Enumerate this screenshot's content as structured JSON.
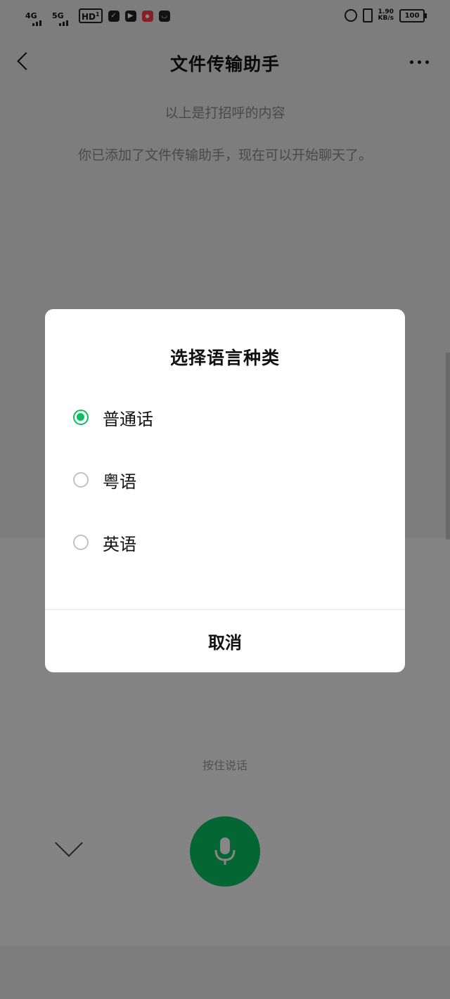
{
  "status_bar": {
    "signal1": "4G",
    "signal2": "5G",
    "hd": "HD",
    "hd_sub": "1",
    "speed_value": "1.90",
    "speed_unit": "KB/s",
    "battery": "100"
  },
  "nav": {
    "title": "文件传输助手"
  },
  "chat": {
    "system_msg_1": "以上是打招呼的内容",
    "system_msg_2": "你已添加了文件传输助手，现在可以开始聊天了。"
  },
  "dialog": {
    "title": "选择语言种类",
    "options": [
      {
        "label": "普通话",
        "selected": true
      },
      {
        "label": "粤语",
        "selected": false
      },
      {
        "label": "英语",
        "selected": false
      }
    ],
    "cancel_label": "取消"
  },
  "voice": {
    "hint": "按住说话"
  },
  "colors": {
    "accent": "#07c160",
    "background": "#ededed",
    "dialog_bg": "#ffffff"
  }
}
